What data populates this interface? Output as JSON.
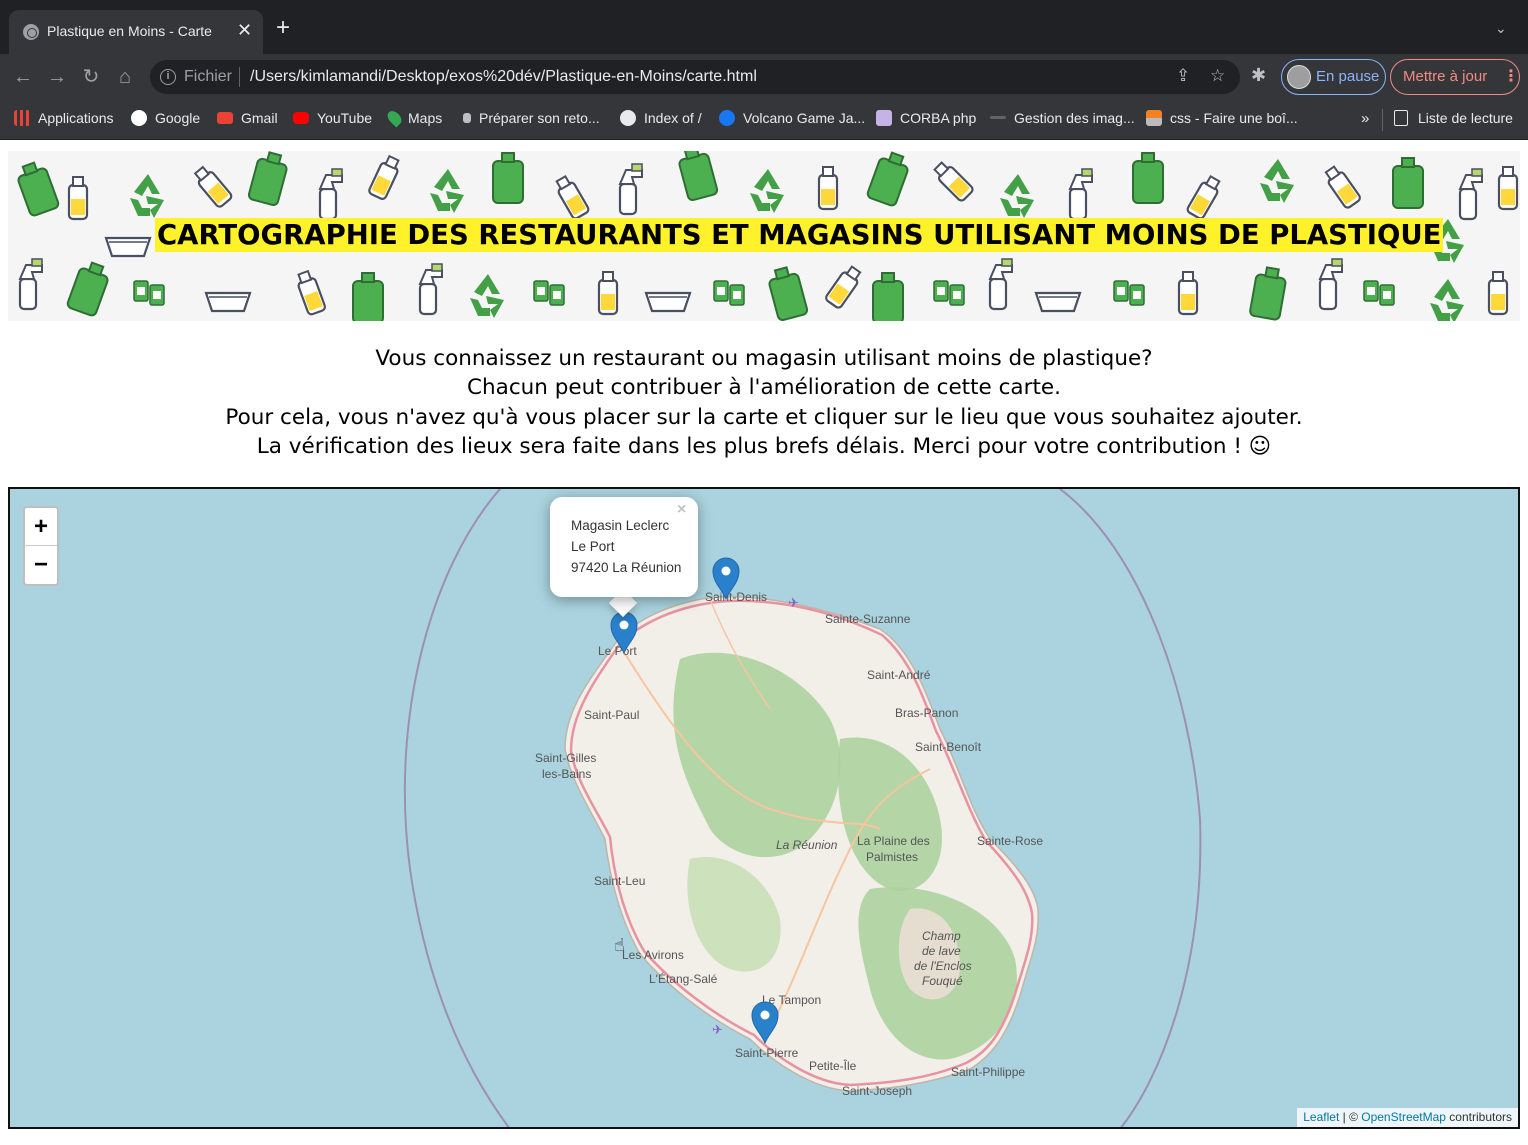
{
  "browser": {
    "tab_title": "Plastique en Moins - Carte",
    "tab_close": "✕",
    "new_tab": "+",
    "tab_list": "⌄",
    "nav": {
      "back": "←",
      "forward": "→",
      "reload": "↻",
      "home": "⌂"
    },
    "scheme": "Fichier",
    "url": "/Users/kimlamandi/Desktop/exos%20dév/Plastique-en-Moins/carte.html",
    "profile_label": "En pause",
    "update_label": "Mettre à jour",
    "update_menu": "⋮",
    "extension_icon": "✱"
  },
  "bookmarks": [
    {
      "label": "Applications",
      "icon": "apps-grid-icon",
      "color": "#ea4335"
    },
    {
      "label": "Google",
      "icon": "google-icon",
      "color": "#ffffff"
    },
    {
      "label": "Gmail",
      "icon": "gmail-icon",
      "color": "#ea4335"
    },
    {
      "label": "YouTube",
      "icon": "youtube-icon",
      "color": "#ff0000"
    },
    {
      "label": "Maps",
      "icon": "maps-icon",
      "color": "#34a853"
    },
    {
      "label": "Préparer son reto...",
      "icon": "page-icon",
      "color": "#bdc1c6"
    },
    {
      "label": "Index of /",
      "icon": "globe-icon",
      "color": "#bdc1c6"
    },
    {
      "label": "Volcano Game Ja...",
      "icon": "facebook-icon",
      "color": "#1877f2"
    },
    {
      "label": "CORBA php",
      "icon": "bookmark-icon",
      "color": "#b39ddb"
    },
    {
      "label": "Gestion des imag...",
      "icon": "dash-icon",
      "color": "#5f6368"
    },
    {
      "label": "css - Faire une boî...",
      "icon": "stackoverflow-icon",
      "color": "#f48024"
    }
  ],
  "bookmarks_more": "»",
  "reading_list": "Liste de lecture",
  "page": {
    "title": "CARTOGRAPHIE DES RESTAURANTS ET MAGASINS UTILISANT MOINS DE PLASTIQUE",
    "intro": [
      "Vous connaissez un restaurant ou magasin utilisant moins de plastique?",
      "Chacun peut contribuer à l'amélioration de cette carte.",
      "Pour cela, vous n'avez qu'à vous placer sur la carte et cliquer sur le lieu que vous souhaitez ajouter.",
      "La vérification des lieux sera faite dans les plus brefs délais. Merci pour votre contribution ! ☺"
    ],
    "accent_yellow": "#fff22a"
  },
  "map": {
    "zoom_in": "+",
    "zoom_out": "−",
    "popup": {
      "close": "×",
      "lines": [
        "Magasin Leclerc",
        "Le Port",
        "97420 La Réunion"
      ]
    },
    "place_labels": {
      "saint_denis": "Saint-Denis",
      "sainte_suzanne": "Sainte-Suzanne",
      "le_port": "Le Port",
      "saint_andre": "Saint-André",
      "saint_paul": "Saint-Paul",
      "bras_panon": "Bras-Panon",
      "saint_benoit": "Saint-Benoît",
      "saint_gilles_1": "Saint-Gilles",
      "saint_gilles_2": "les-Bains",
      "la_reunion": "La Réunion",
      "plaine_1": "La Plaine des",
      "plaine_2": "Palmistes",
      "sainte_rose": "Sainte-Rose",
      "saint_leu": "Saint-Leu",
      "enclos_1": "Champ",
      "enclos_2": "de lave",
      "enclos_3": "de l'Enclos",
      "enclos_4": "Fouqué",
      "les_avirons": "Les Avirons",
      "etang_sale": "L'Étang-Salé",
      "tampon_1": "Le Tampon",
      "saint_pierre": "Saint-Pierre",
      "petite_ile": "Petite-Île",
      "saint_philippe": "Saint-Philippe",
      "saint_joseph": "Saint-Joseph"
    },
    "attribution": {
      "leaflet": "Leaflet",
      "sep": " | © ",
      "osm": "OpenStreetMap",
      "suffix": " contributors"
    },
    "colors": {
      "sea": "#aad3df",
      "land": "#f2efe9",
      "forest": "#add19e",
      "road": "#e892a2",
      "marker": "#2a81cb"
    }
  }
}
